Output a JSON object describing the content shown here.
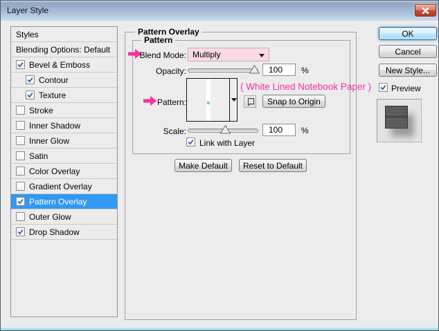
{
  "window": {
    "title": "Layer Style"
  },
  "sidebar": {
    "items": [
      {
        "label": "Styles",
        "checkbox": false
      },
      {
        "label": "Blending Options: Default",
        "checkbox": false
      },
      {
        "label": "Bevel & Emboss",
        "checkbox": true,
        "checked": true
      },
      {
        "label": "Contour",
        "checkbox": true,
        "checked": true,
        "indent": true
      },
      {
        "label": "Texture",
        "checkbox": true,
        "checked": true,
        "indent": true
      },
      {
        "label": "Stroke",
        "checkbox": true,
        "checked": false
      },
      {
        "label": "Inner Shadow",
        "checkbox": true,
        "checked": false
      },
      {
        "label": "Inner Glow",
        "checkbox": true,
        "checked": false
      },
      {
        "label": "Satin",
        "checkbox": true,
        "checked": false
      },
      {
        "label": "Color Overlay",
        "checkbox": true,
        "checked": false
      },
      {
        "label": "Gradient Overlay",
        "checkbox": true,
        "checked": false
      },
      {
        "label": "Pattern Overlay",
        "checkbox": true,
        "checked": true,
        "selected": true
      },
      {
        "label": "Outer Glow",
        "checkbox": true,
        "checked": false
      },
      {
        "label": "Drop Shadow",
        "checkbox": true,
        "checked": true
      }
    ]
  },
  "pattern_overlay": {
    "group_title": "Pattern Overlay",
    "pattern_group_title": "Pattern",
    "blend_mode_label": "Blend Mode:",
    "blend_mode_value": "Multiply",
    "opacity_label": "Opacity:",
    "opacity_value": "100",
    "opacity_unit": "%",
    "pattern_label": "Pattern:",
    "pattern_annotation": "( White Lined Notebook Paper )",
    "new_preset_icon": "new-preset-icon",
    "snap_to_origin_label": "Snap to Origin",
    "scale_label": "Scale:",
    "scale_value": "100",
    "scale_unit": "%",
    "link_with_layer_label": "Link with Layer",
    "link_with_layer_checked": true,
    "make_default_label": "Make Default",
    "reset_to_default_label": "Reset to Default"
  },
  "action_buttons": {
    "ok": "OK",
    "cancel": "Cancel",
    "new_style": "New Style...",
    "preview_label": "Preview",
    "preview_checked": true
  },
  "sliders": {
    "opacity_thumb_percent": 95,
    "scale_thumb_percent": 53
  },
  "colors": {
    "selection_blue": "#3398f2",
    "annotation_pink": "#f8309a",
    "pattern_dot_cyan": "#6ecbd1",
    "dialog_bg": "#ececec",
    "titlebar_top": "#93a9c5",
    "titlebar_bottom": "#c8daee",
    "close_button_red": "#c6513a"
  }
}
